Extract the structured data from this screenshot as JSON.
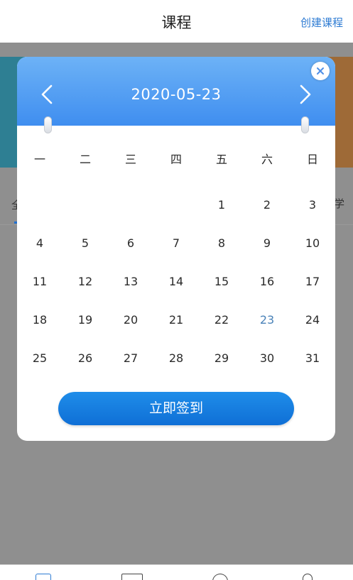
{
  "topbar": {
    "title": "课程",
    "create_label": "创建课程"
  },
  "background": {
    "tab_left": "全",
    "tab_right": "学"
  },
  "calendar": {
    "date": "2020-05-23",
    "weekdays": [
      "一",
      "二",
      "三",
      "四",
      "五",
      "六",
      "日"
    ],
    "weeks": [
      [
        "",
        "",
        "",
        "",
        "1",
        "2",
        "3"
      ],
      [
        "4",
        "5",
        "6",
        "7",
        "8",
        "9",
        "10"
      ],
      [
        "11",
        "12",
        "13",
        "14",
        "15",
        "16",
        "17"
      ],
      [
        "18",
        "19",
        "20",
        "21",
        "22",
        "23",
        "24"
      ],
      [
        "25",
        "26",
        "27",
        "28",
        "29",
        "30",
        "31"
      ]
    ],
    "selected_day": "23",
    "checkin_label": "立即签到"
  },
  "icons": {
    "prev": "chevron-left-icon",
    "next": "chevron-right-icon",
    "close": "close-icon"
  },
  "colors": {
    "header_top": "#6db2f6",
    "header_bottom": "#3f8ef0",
    "accent": "#2d7bd3",
    "button": "#1479dd",
    "selected_day": "#4a82b8"
  }
}
